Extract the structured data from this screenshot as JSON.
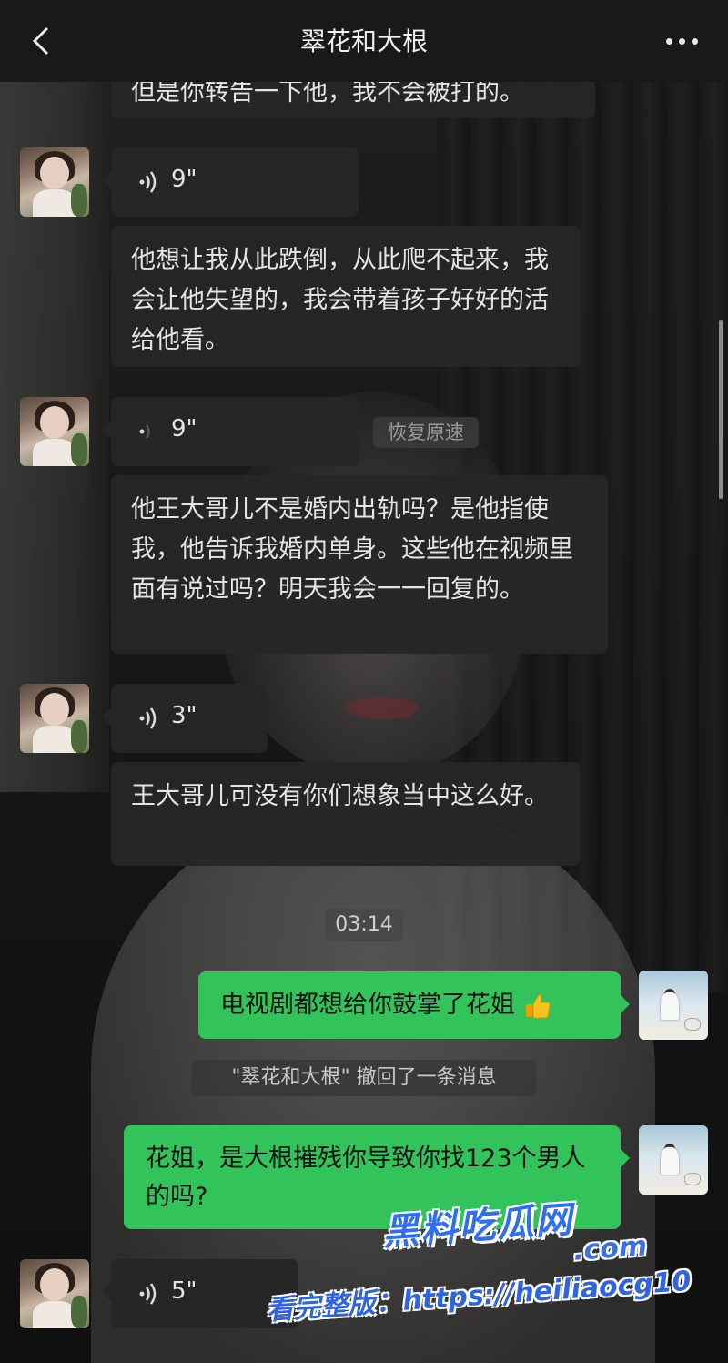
{
  "header": {
    "title": "翠花和大根"
  },
  "messages": {
    "m0_text": "但是你转告一下他，我不会被打的。",
    "v1_dur": "9\"",
    "m1_text": "他想让我从此跌倒，从此爬不起来，我会让他失望的，我会带着孩子好好的活给他看。",
    "v2_dur": "9\"",
    "speed_chip": "恢复原速",
    "m2_text": "他王大哥儿不是婚内出轨吗？是他指使我，他告诉我婚内单身。这些他在视频里面有说过吗？明天我会一一回复的。",
    "v3_dur": "3\"",
    "m3_text": "王大哥儿可没有你们想象当中这么好。",
    "time_label": "03:14",
    "g1_text": "电视剧都想给你鼓掌了花姐",
    "recall_notice": "\"翠花和大根\" 撤回了一条消息",
    "g2_text": "花姐，是大根摧残你导致你找123个男人的吗?",
    "v4_dur": "5\""
  },
  "watermark": {
    "logo": "黑料吃瓜网",
    "site": ".com",
    "line": "看完整版：https://heiliaocg10"
  },
  "colors": {
    "green_bubble": "#32c35b",
    "dark_bubble": "#262626",
    "accent_blue": "#2f6df2"
  }
}
